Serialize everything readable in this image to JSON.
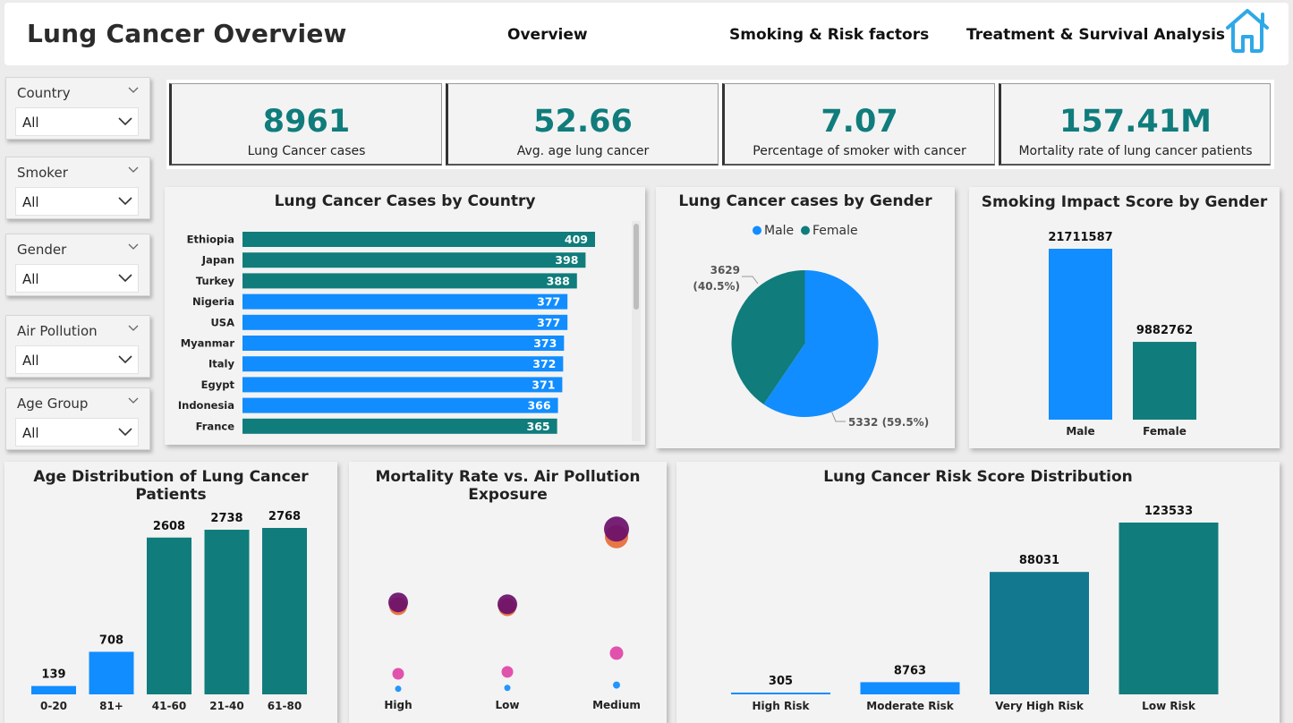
{
  "header": {
    "title": "Lung Cancer Overview",
    "nav": [
      "Overview",
      "Smoking & Risk factors",
      "Treatment & Survival Analysis"
    ],
    "home_icon": "home-icon"
  },
  "colors": {
    "teal": "#107c7c",
    "blue": "#118dff",
    "purple": "#6b0f6b",
    "orange": "#e66c37",
    "pink": "#e044a7",
    "darkTeal": "#12788f"
  },
  "slicers": [
    {
      "label": "Country",
      "value": "All"
    },
    {
      "label": "Smoker",
      "value": "All"
    },
    {
      "label": "Gender",
      "value": "All"
    },
    {
      "label": "Air Pollution",
      "value": "All"
    },
    {
      "label": "Age Group",
      "value": "All"
    }
  ],
  "kpis": [
    {
      "value": "8961",
      "caption": "Lung Cancer cases"
    },
    {
      "value": "52.66",
      "caption": "Avg. age lung cancer"
    },
    {
      "value": "7.07",
      "caption": "Percentage of smoker with cancer"
    },
    {
      "value": "157.41M",
      "caption": "Mortality rate of lung cancer patients"
    }
  ],
  "panels": {
    "country": "Lung Cancer Cases by Country",
    "gender_pie": "Lung Cancer cases by Gender",
    "smoking_impact": "Smoking Impact Score by Gender",
    "age_dist": "Age Distribution of Lung Cancer Patients",
    "mortality": "Mortality Rate vs. Air Pollution Exposure",
    "risk": "Lung Cancer Risk Score Distribution"
  },
  "chart_data": [
    {
      "id": "country",
      "type": "bar",
      "orientation": "horizontal",
      "title": "Lung Cancer Cases by Country",
      "categories": [
        "Ethiopia",
        "Japan",
        "Turkey",
        "Nigeria",
        "USA",
        "Myanmar",
        "Italy",
        "Egypt",
        "Indonesia",
        "France"
      ],
      "values": [
        409,
        398,
        388,
        377,
        377,
        373,
        372,
        371,
        366,
        365
      ],
      "colors": [
        "#107c7c",
        "#107c7c",
        "#107c7c",
        "#118dff",
        "#118dff",
        "#118dff",
        "#118dff",
        "#118dff",
        "#118dff",
        "#107c7c"
      ],
      "xlim": [
        0,
        409
      ]
    },
    {
      "id": "gender_pie",
      "type": "pie",
      "title": "Lung Cancer cases by Gender",
      "legend": [
        "Male",
        "Female"
      ],
      "legend_position": "top",
      "slices": [
        {
          "name": "Male",
          "value": 5332,
          "label": "5332 (59.5%)",
          "color": "#118dff"
        },
        {
          "name": "Female",
          "value": 3629,
          "label_line1": "3629",
          "label_line2": "(40.5%)",
          "color": "#107c7c"
        }
      ]
    },
    {
      "id": "smoking_impact",
      "type": "bar",
      "title": "Smoking Impact Score by Gender",
      "categories": [
        "Male",
        "Female"
      ],
      "values": [
        21711587,
        9882762
      ],
      "colors": [
        "#118dff",
        "#107c7c"
      ],
      "ylim": [
        0,
        21711587
      ]
    },
    {
      "id": "age_dist",
      "type": "bar",
      "title": "Age Distribution of Lung Cancer Patients",
      "categories": [
        "0-20",
        "81+",
        "41-60",
        "21-40",
        "61-80"
      ],
      "values": [
        139,
        708,
        2608,
        2738,
        2768
      ],
      "colors": [
        "#118dff",
        "#118dff",
        "#107c7c",
        "#107c7c",
        "#107c7c"
      ],
      "ylim": [
        0,
        2768
      ]
    },
    {
      "id": "mortality",
      "type": "scatter",
      "title": "Mortality Rate vs. Air Pollution Exposure",
      "categories": [
        "High",
        "Low",
        "Medium"
      ],
      "series": [
        {
          "color": "#6b0f6b",
          "values": [
            48,
            47,
            87
          ],
          "size": [
            11,
            11,
            14
          ]
        },
        {
          "color": "#e66c37",
          "values": [
            46,
            45.5,
            83
          ],
          "size": [
            10,
            10,
            13
          ]
        },
        {
          "color": "#e044a7",
          "values": [
            10,
            11,
            21
          ],
          "size": [
            6.5,
            6.5,
            7.5
          ]
        },
        {
          "color": "#118dff",
          "values": [
            2,
            2.5,
            4
          ],
          "size": [
            3.5,
            3.5,
            4
          ]
        }
      ],
      "ylim": [
        0,
        100
      ]
    },
    {
      "id": "risk",
      "type": "bar",
      "title": "Lung Cancer Risk Score Distribution",
      "categories": [
        "High Risk",
        "Moderate Risk",
        "Very High Risk",
        "Low Risk"
      ],
      "values": [
        305,
        8763,
        88031,
        123533
      ],
      "colors": [
        "#118dff",
        "#118dff",
        "#12788f",
        "#107c7c"
      ],
      "ylim": [
        0,
        123533
      ]
    }
  ]
}
